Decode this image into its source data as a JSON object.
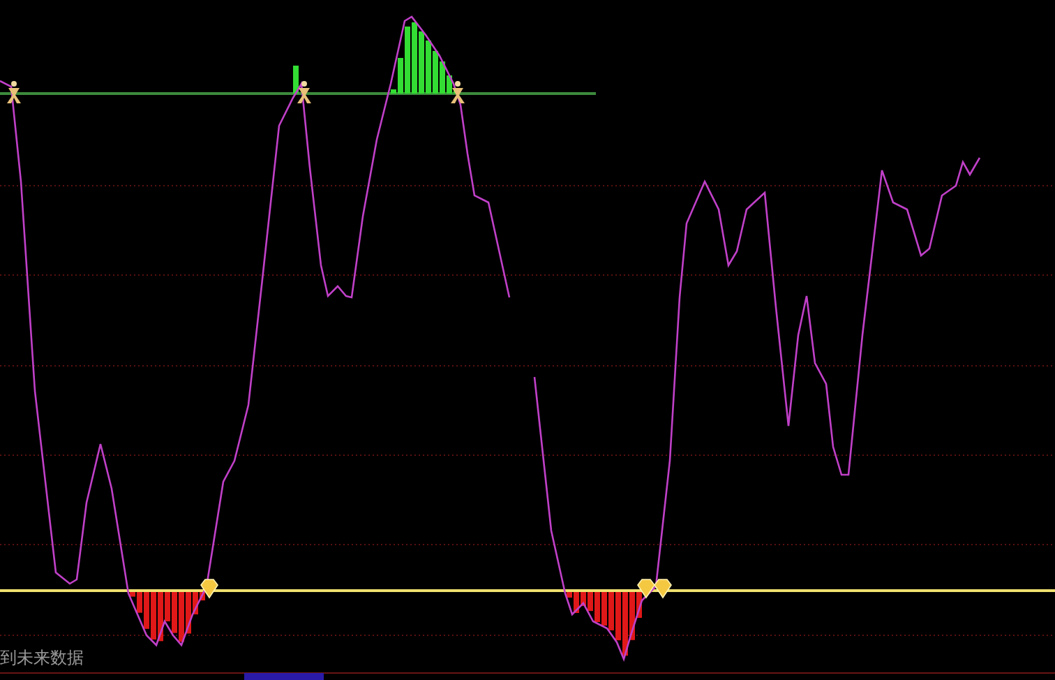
{
  "chart_footer": {
    "notice": "到未来数据"
  }
}
